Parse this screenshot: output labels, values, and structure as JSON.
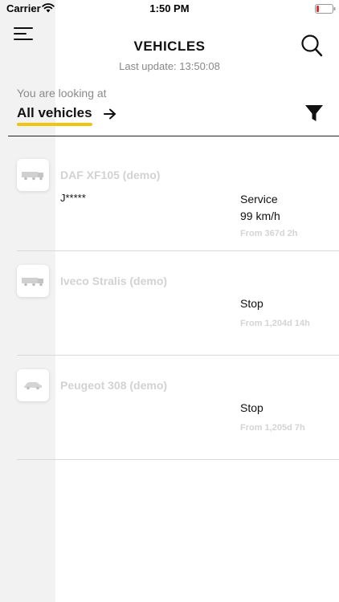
{
  "status_bar": {
    "carrier": "Carrier",
    "time": "1:50 PM",
    "battery_color": "#e03131"
  },
  "header": {
    "title": "VEHICLES",
    "last_update": "Last update: 13:50:08",
    "menu_icon": "hamburger-menu-icon",
    "search_icon": "search-icon"
  },
  "filter": {
    "looking_label": "You are looking at",
    "scope": "All vehicles",
    "scope_accent_color": "#f1c40f",
    "arrow_icon": "arrow-right-icon",
    "filter_icon": "funnel-filter-icon"
  },
  "vehicles": [
    {
      "name": "DAF XF105 (demo)",
      "icon": "truck-icon",
      "driver": "J*****",
      "status": "Service",
      "speed": "99 km/h",
      "since": "From 367d 2h"
    },
    {
      "name": "Iveco Stralis (demo)",
      "icon": "truck-icon",
      "driver": "",
      "status": "Stop",
      "speed": "",
      "since": "From 1,204d 14h"
    },
    {
      "name": "Peugeot 308 (demo)",
      "icon": "car-icon",
      "driver": "",
      "status": "Stop",
      "speed": "",
      "since": "From 1,205d 7h"
    }
  ]
}
